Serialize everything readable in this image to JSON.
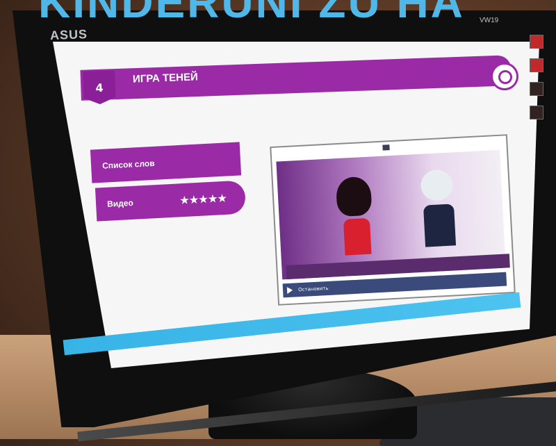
{
  "overlay": {
    "headline": "KINDERUNI ZU HA"
  },
  "monitor": {
    "brand": "ASUS",
    "model": "VW19"
  },
  "app": {
    "level_number": "4",
    "title": "ИГРА ТЕНЕЙ",
    "menu": [
      {
        "label": "Список слов"
      },
      {
        "label": "Видео",
        "stars": "★★★★★"
      }
    ]
  },
  "video": {
    "controls_label": "Остановить"
  },
  "colors": {
    "accent": "#9a2aa6",
    "headline": "#4fb8e8"
  }
}
